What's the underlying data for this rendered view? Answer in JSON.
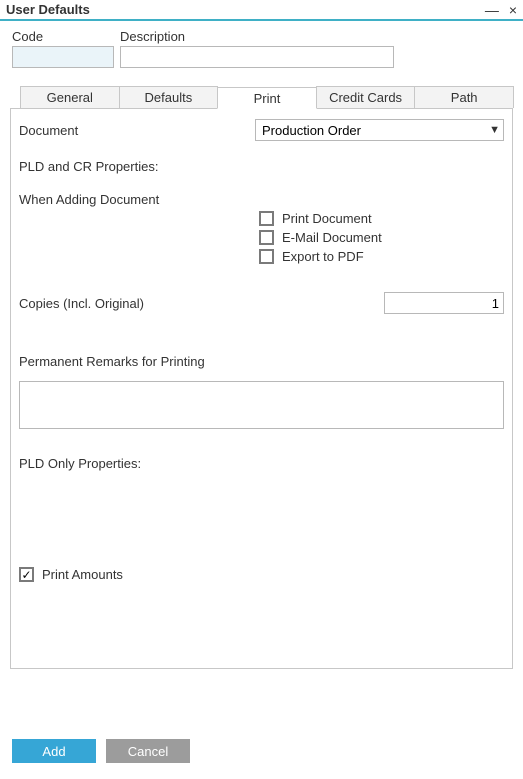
{
  "window": {
    "title": "User Defaults",
    "minimize": "—",
    "close": "×"
  },
  "top": {
    "code_label": "Code",
    "code_value": "",
    "desc_label": "Description",
    "desc_value": ""
  },
  "tabs": {
    "items": [
      {
        "label": "General"
      },
      {
        "label": "Defaults"
      },
      {
        "label": "Print"
      },
      {
        "label": "Credit Cards"
      },
      {
        "label": "Path"
      }
    ],
    "active_index": 2
  },
  "print": {
    "document_label": "Document",
    "document_value": "Production Order",
    "pld_cr_header": "PLD and CR Properties:",
    "when_adding_label": "When Adding Document",
    "chk_print_label": "Print Document",
    "chk_print_checked": false,
    "chk_email_label": "E-Mail Document",
    "chk_email_checked": false,
    "chk_export_label": "Export to PDF",
    "chk_export_checked": false,
    "copies_label": "Copies (Incl. Original)",
    "copies_value": "1",
    "remarks_label": "Permanent Remarks for Printing",
    "remarks_value": "",
    "pld_only_header": "PLD Only Properties:",
    "chk_amounts_label": "Print Amounts",
    "chk_amounts_checked": true
  },
  "footer": {
    "add_label": "Add",
    "cancel_label": "Cancel"
  }
}
